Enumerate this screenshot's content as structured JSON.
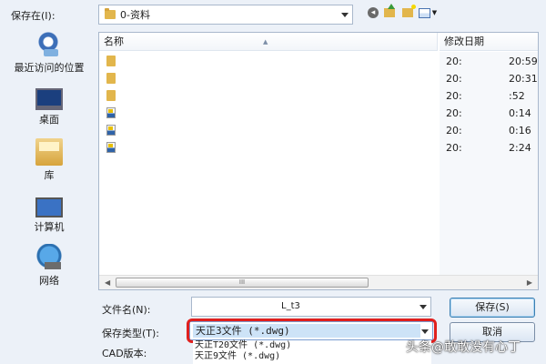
{
  "top": {
    "save_in_label": "保存在(I):",
    "save_in_value": "0-资料"
  },
  "places": [
    {
      "label": "最近访问的位置",
      "icon": "recent-places-icon"
    },
    {
      "label": "桌面",
      "icon": "desktop-icon"
    },
    {
      "label": "库",
      "icon": "library-icon"
    },
    {
      "label": "计算机",
      "icon": "computer-icon"
    },
    {
      "label": "网络",
      "icon": "network-icon"
    }
  ],
  "list": {
    "col_name": "名称",
    "col_date": "修改日期",
    "rows": [
      {
        "type": "folder",
        "name": "",
        "date_start": "20:",
        "date_end": "20:59"
      },
      {
        "type": "folder",
        "name": "",
        "date_start": "20:",
        "date_end": "20:31"
      },
      {
        "type": "folder",
        "name": "",
        "date_start": "20:",
        "date_end": ":52"
      },
      {
        "type": "dwg",
        "name": "",
        "date_start": "20:",
        "date_end": "0:14"
      },
      {
        "type": "dwg",
        "name": "",
        "date_start": "20:",
        "date_end": "0:16"
      },
      {
        "type": "dwg",
        "name": "",
        "date_start": "20:",
        "date_end": "2:24"
      }
    ],
    "scroll_thumb": "III"
  },
  "form": {
    "filename_label": "文件名(N):",
    "filename_value": "L_t3",
    "filetype_label": "保存类型(T):",
    "filetype_value": "天正3文件 (*.dwg)",
    "cad_label": "CAD版本:",
    "dropdown_options": [
      "天正T20文件 (*.dwg)",
      "天正9文件 (*.dwg)"
    ]
  },
  "buttons": {
    "save": "保存(S)",
    "cancel": "取消"
  },
  "watermark": "头条@敢敢没有心丁",
  "colors": {
    "highlight_ring": "#e0201e",
    "selection": "#cde3f7"
  }
}
